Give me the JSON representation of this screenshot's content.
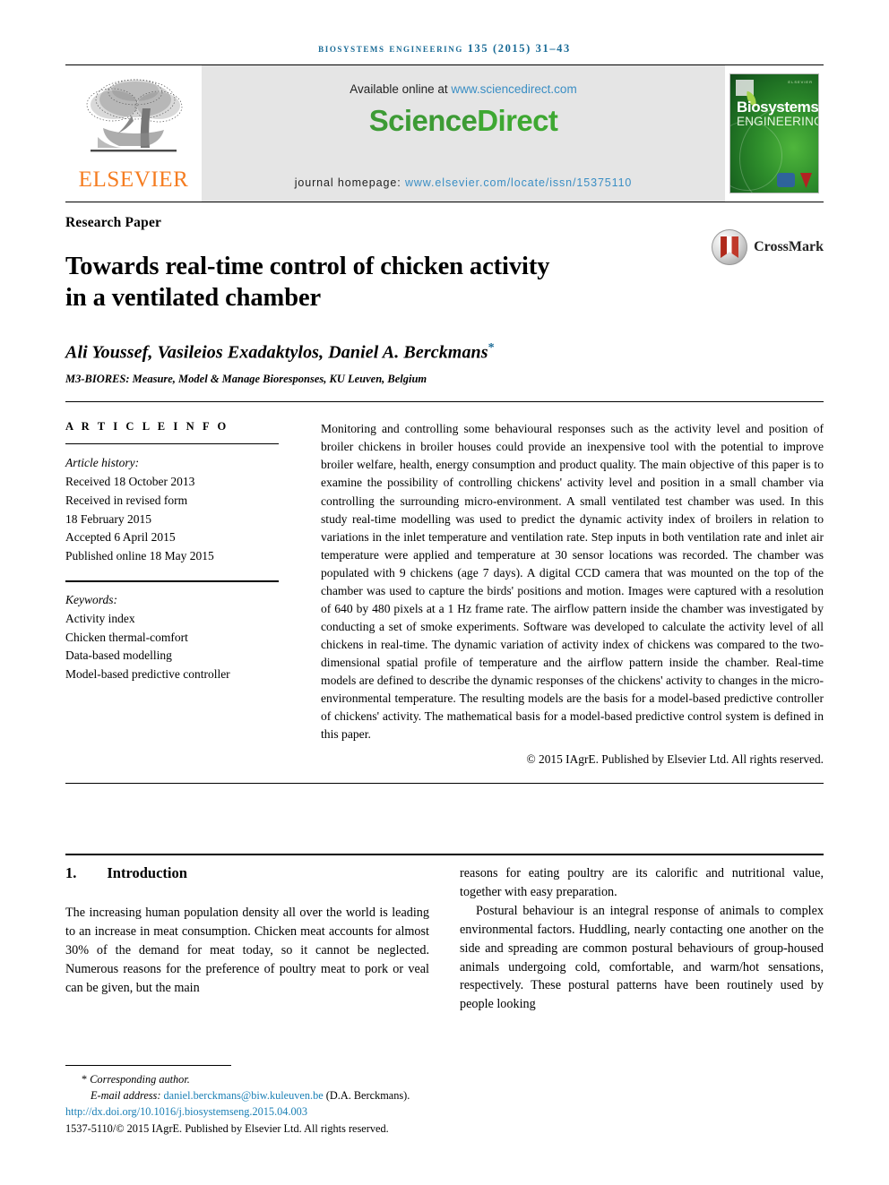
{
  "running_head": "biosystems engineering 135 (2015) 31–43",
  "masthead": {
    "publisher_name": "ELSEVIER",
    "publisher_logo_name": "elsevier-tree-logo",
    "available_prefix": "Available online at ",
    "available_link": "www.sciencedirect.com",
    "sciencedirect_part1": "Science",
    "sciencedirect_part2": "Direct",
    "homepage_label": "journal homepage: ",
    "homepage_link": "www.elsevier.com/locate/issn/15375110",
    "cover": {
      "title_line1": "Biosystems",
      "title_line2": "ENGINEERING",
      "top_text": "ELSEVIER"
    }
  },
  "article": {
    "kind": "Research Paper",
    "title_line1": "Towards real-time control of chicken activity",
    "title_line2": "in a ventilated chamber",
    "crossmark_label": "CrossMark",
    "authors": "Ali Youssef, Vasileios Exadaktylos, Daniel A. Berckmans",
    "corresponding_marker": "*",
    "affiliation": "M3-BIORES: Measure, Model & Manage Bioresponses, KU Leuven, Belgium"
  },
  "article_info": {
    "heading": "A R T I C L E   I N F O",
    "history_label": "Article history:",
    "history": [
      "Received 18 October 2013",
      "Received in revised form",
      "18 February 2015",
      "Accepted 6 April 2015",
      "Published online 18 May 2015"
    ],
    "keywords_label": "Keywords:",
    "keywords": [
      "Activity index",
      "Chicken thermal-comfort",
      "Data-based modelling",
      "Model-based predictive controller"
    ]
  },
  "abstract": {
    "text": "Monitoring and controlling some behavioural responses such as the activity level and position of broiler chickens in broiler houses could provide an inexpensive tool with the potential to improve broiler welfare, health, energy consumption and product quality. The main objective of this paper is to examine the possibility of controlling chickens' activity level and position in a small chamber via controlling the surrounding micro-environment. A small ventilated test chamber was used. In this study real-time modelling was used to predict the dynamic activity index of broilers in relation to variations in the inlet temperature and ventilation rate. Step inputs in both ventilation rate and inlet air temperature were applied and temperature at 30 sensor locations was recorded. The chamber was populated with 9 chickens (age 7 days). A digital CCD camera that was mounted on the top of the chamber was used to capture the birds' positions and motion. Images were captured with a resolution of 640 by 480 pixels at a 1 Hz frame rate. The airflow pattern inside the chamber was investigated by conducting a set of smoke experiments. Software was developed to calculate the activity level of all chickens in real-time. The dynamic variation of activity index of chickens was compared to the two-dimensional spatial profile of temperature and the airflow pattern inside the chamber. Real-time models are defined to describe the dynamic responses of the chickens' activity to changes in the micro-environmental temperature. The resulting models are the basis for a model-based predictive controller of chickens' activity. The mathematical basis for a model-based predictive control system is defined in this paper.",
    "copyright": "© 2015 IAgrE. Published by Elsevier Ltd. All rights reserved."
  },
  "body": {
    "section_number": "1.",
    "section_name": "Introduction",
    "left_paragraph": "The increasing human population density all over the world is leading to an increase in meat consumption. Chicken meat accounts for almost 30% of the demand for meat today, so it cannot be neglected. Numerous reasons for the preference of poultry meat to pork or veal can be given, but the main",
    "right_paragraph_1": "reasons for eating poultry are its calorific and nutritional value, together with easy preparation.",
    "right_paragraph_2": "Postural behaviour is an integral response of animals to complex environmental factors. Huddling, nearly contacting one another on the side and spreading are common postural behaviours of group-housed animals undergoing cold, comfortable, and warm/hot sensations, respectively. These postural patterns have been routinely used by people looking"
  },
  "footnote": {
    "corresponding_marker": "*",
    "corresponding_text": "Corresponding author.",
    "email_label": "E-mail address: ",
    "email_address": "daniel.berckmans@biw.kuleuven.be",
    "email_suffix": " (D.A. Berckmans).",
    "doi": "http://dx.doi.org/10.1016/j.biosystemseng.2015.04.003",
    "issn_line": "1537-5110/© 2015 IAgrE. Published by Elsevier Ltd. All rights reserved."
  },
  "colors": {
    "header_blue": "#1a6b96",
    "link_blue": "#3a8ec4",
    "elsevier_orange": "#f57c20",
    "sciencedirect_green": "#3d9b35",
    "cover_green": "#2f8f2c",
    "crossmark_red": "#b02a1c",
    "banner_gray": "#e5e5e5"
  }
}
